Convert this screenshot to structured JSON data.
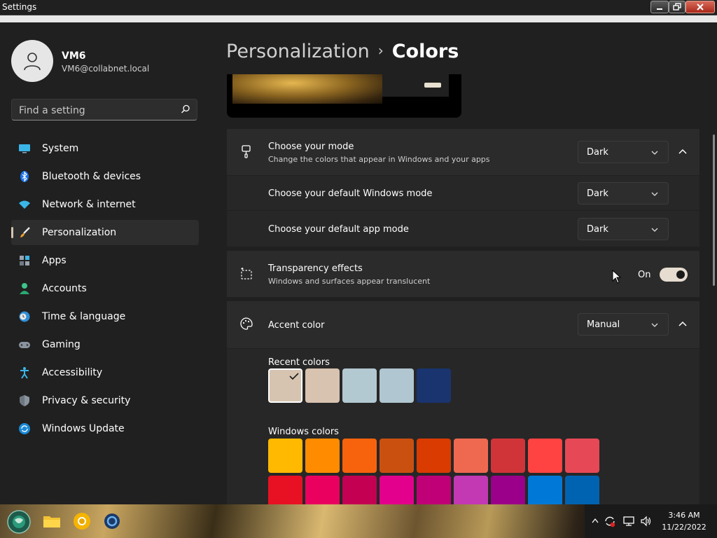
{
  "window": {
    "title": "Settings"
  },
  "user": {
    "name": "VM6",
    "email": "VM6@collabnet.local"
  },
  "search": {
    "placeholder": "Find a setting"
  },
  "sidebar": {
    "items": [
      {
        "label": "System",
        "icon": "system-icon"
      },
      {
        "label": "Bluetooth & devices",
        "icon": "bluetooth-icon"
      },
      {
        "label": "Network & internet",
        "icon": "wifi-icon"
      },
      {
        "label": "Personalization",
        "icon": "brush-icon",
        "active": true
      },
      {
        "label": "Apps",
        "icon": "apps-icon"
      },
      {
        "label": "Accounts",
        "icon": "person-icon"
      },
      {
        "label": "Time & language",
        "icon": "clock-globe-icon"
      },
      {
        "label": "Gaming",
        "icon": "gamepad-icon"
      },
      {
        "label": "Accessibility",
        "icon": "accessibility-icon"
      },
      {
        "label": "Privacy & security",
        "icon": "shield-icon"
      },
      {
        "label": "Windows Update",
        "icon": "update-icon"
      }
    ]
  },
  "header": {
    "parent": "Personalization",
    "separator": "›",
    "current": "Colors"
  },
  "mode": {
    "title": "Choose your mode",
    "subtitle": "Change the colors that appear in Windows and your apps",
    "value": "Dark",
    "windows_mode_label": "Choose your default Windows mode",
    "windows_mode_value": "Dark",
    "app_mode_label": "Choose your default app mode",
    "app_mode_value": "Dark"
  },
  "transparency": {
    "title": "Transparency effects",
    "subtitle": "Windows and surfaces appear translucent",
    "state": "On"
  },
  "accent": {
    "title": "Accent color",
    "value": "Manual"
  },
  "recent_colors": {
    "label": "Recent colors",
    "colors": [
      "#d6c4b0",
      "#d8c3b0",
      "#b3c9d2",
      "#b0c6d0",
      "#19346f"
    ],
    "selected_index": 0
  },
  "windows_colors": {
    "label": "Windows colors",
    "row1": [
      "#ffb900",
      "#ff8c00",
      "#f7630c",
      "#ca5010",
      "#da3b01",
      "#ef6950",
      "#d13438",
      "#ff4343",
      "#e74856"
    ],
    "row2": [
      "#e81123",
      "#ea005e",
      "#c30052",
      "#e3008c",
      "#bf0077",
      "#c239b3",
      "#9a0089",
      "#0078d7",
      "#0063b1"
    ]
  },
  "taskbar": {
    "time": "3:46 AM",
    "date": "11/22/2022"
  },
  "colors": {
    "accent": "#d6c4b0",
    "background": "#202020",
    "card": "#2b2b2b"
  }
}
